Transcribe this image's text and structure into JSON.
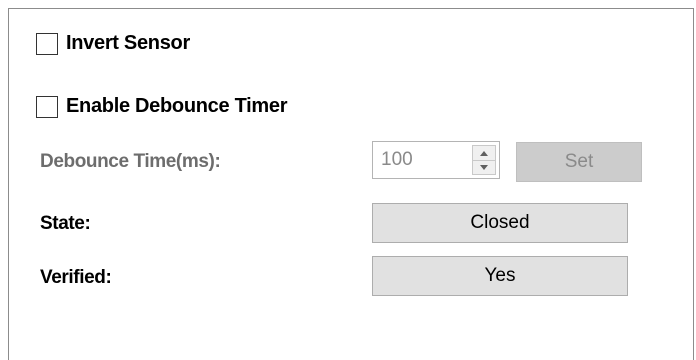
{
  "options": {
    "invert_sensor": {
      "label": "Invert Sensor",
      "checked": false
    },
    "enable_debounce": {
      "label": "Enable Debounce Timer",
      "checked": false
    }
  },
  "debounce": {
    "label": "Debounce Time(ms):",
    "value": "100",
    "set_label": "Set",
    "enabled": false
  },
  "state": {
    "label": "State:",
    "value": "Closed"
  },
  "verified": {
    "label": "Verified:",
    "value": "Yes"
  },
  "icons": {
    "spin_up": "spin-up-arrow",
    "spin_down": "spin-down-arrow"
  },
  "colors": {
    "border": "#8c8c8c",
    "disabled_text": "#6d6d6d",
    "button_face": "#e1e1e1",
    "disabled_button": "#cccccc"
  }
}
